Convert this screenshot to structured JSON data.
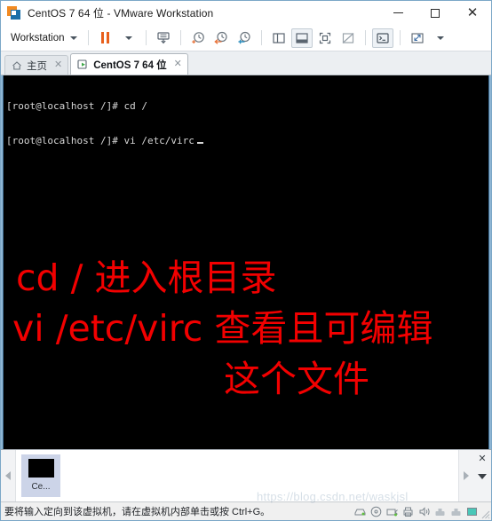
{
  "window": {
    "title": "CentOS 7 64 位 - VMware Workstation",
    "app_icon": "vmware-logo-icon",
    "controls": {
      "minimize": "—",
      "maximize": "□",
      "close": "✕"
    }
  },
  "toolbar": {
    "menu_label": "Workstation",
    "buttons": [
      {
        "name": "pause-vm",
        "icon": "pause-icon"
      },
      {
        "name": "pause-dropdown",
        "icon": "chevron-down-icon"
      },
      {
        "name": "send-ctrl-alt-del",
        "icon": "keyboard-send-icon"
      },
      {
        "name": "take-snapshot",
        "icon": "snapshot-add-icon"
      },
      {
        "name": "revert-snapshot",
        "icon": "snapshot-revert-icon"
      },
      {
        "name": "snapshot-manager",
        "icon": "snapshot-manager-icon"
      },
      {
        "name": "show-library",
        "icon": "sidebar-panel-icon"
      },
      {
        "name": "show-thumbnail-bar",
        "icon": "bottom-panel-icon"
      },
      {
        "name": "full-screen",
        "icon": "fullscreen-icon"
      },
      {
        "name": "unity-mode",
        "icon": "unity-mode-icon"
      },
      {
        "name": "console-view",
        "icon": "console-icon"
      },
      {
        "name": "stretch-view",
        "icon": "expand-arrows-icon"
      },
      {
        "name": "stretch-dropdown",
        "icon": "chevron-down-icon"
      }
    ]
  },
  "tabs": [
    {
      "label": "主页",
      "icon": "home-icon",
      "close": "✕",
      "active": false
    },
    {
      "label": "CentOS 7 64 位",
      "icon": "vm-running-icon",
      "close": "✕",
      "active": true
    }
  ],
  "vm_screen": {
    "terminal": {
      "line1": "[root@localhost /]# cd /",
      "line2": "[root@localhost /]# vi /etc/virc"
    },
    "annotation": {
      "line1": "cd /  进入根目录",
      "line2": "vi /etc/virc 查看且可编辑",
      "line3": "这个文件",
      "color": "#f20000"
    },
    "background": "#000000"
  },
  "thumbnail_bar": {
    "scroll_left": "◀",
    "scroll_right": "▶",
    "close": "✕",
    "dropdown": "▼",
    "items": [
      {
        "label": "Ce...",
        "name": "thumbnail-centos"
      }
    ]
  },
  "statusbar": {
    "message": "要将输入定向到该虚拟机，请在虚拟机内部单击或按 Ctrl+G。",
    "devices": [
      "hard-disk-icon",
      "cd-dvd-icon",
      "network-adapter-icon",
      "printer-icon",
      "sound-card-icon",
      "usb-device-icon",
      "usb-device-2-icon",
      "display-icon"
    ]
  },
  "watermark": {
    "text": "https://blog.csdn.net/waskjsl"
  }
}
